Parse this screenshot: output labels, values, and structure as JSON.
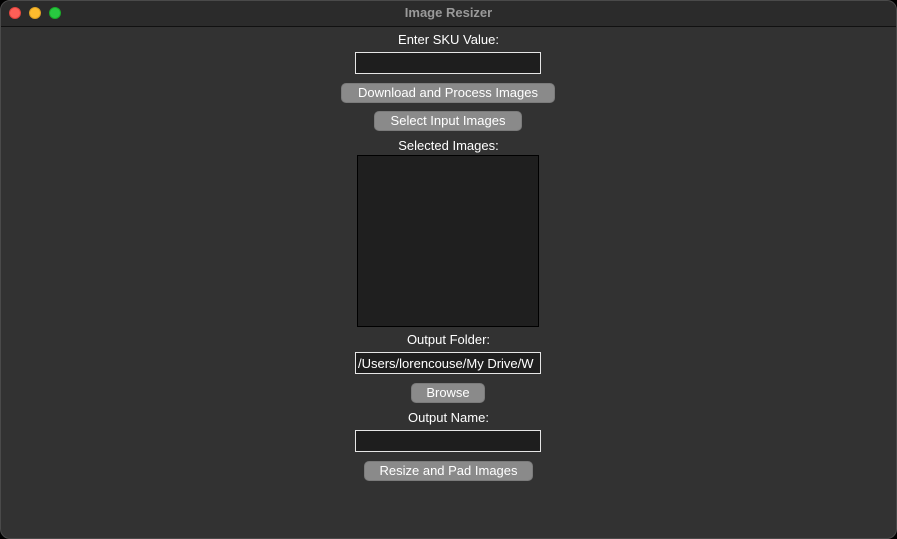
{
  "window": {
    "title": "Image Resizer"
  },
  "sku": {
    "label": "Enter SKU Value:",
    "value": ""
  },
  "buttons": {
    "download_process": "Download and Process Images",
    "select_input": "Select Input Images",
    "browse": "Browse",
    "resize_pad": "Resize and Pad Images"
  },
  "selected_images": {
    "label": "Selected Images:",
    "items": []
  },
  "output_folder": {
    "label": "Output Folder:",
    "value": "/Users/lorencouse/My Drive/W"
  },
  "output_name": {
    "label": "Output Name:",
    "value": ""
  },
  "colors": {
    "window_bg": "#323232",
    "field_bg": "#1e1e1e",
    "button_bg": "#8a8a8a",
    "close": "#fe5f57",
    "minimize": "#febc2e",
    "zoom": "#28c840"
  }
}
